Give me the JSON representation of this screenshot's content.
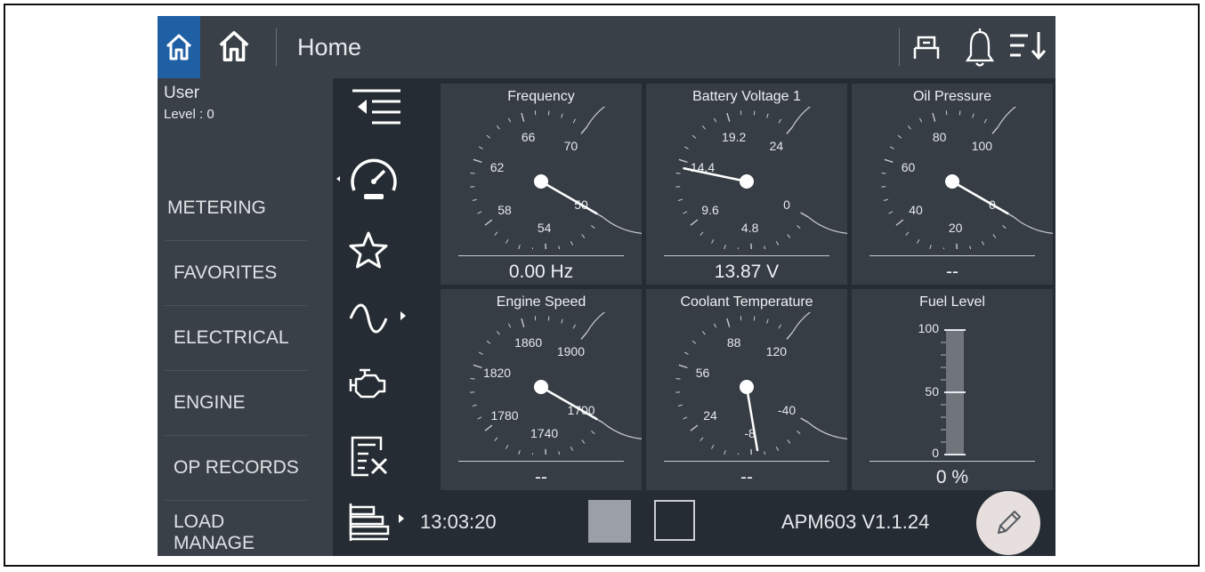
{
  "header": {
    "title": "Home"
  },
  "user": {
    "name": "User",
    "level": "Level  : 0"
  },
  "menu": [
    {
      "label": "METERING"
    },
    {
      "label": "FAVORITES"
    },
    {
      "label": "ELECTRICAL"
    },
    {
      "label": "ENGINE"
    },
    {
      "label": "OP RECORDS"
    },
    {
      "label": "LOAD MANAGE"
    }
  ],
  "gauges": [
    {
      "title": "Frequency",
      "value": "0.00 Hz",
      "ticks": [
        "50",
        "54",
        "58",
        "62",
        "66",
        "70"
      ],
      "needle_fraction": 0.0
    },
    {
      "title": "Battery Voltage 1",
      "value": "13.87 V",
      "ticks": [
        "0",
        "4.8",
        "9.6",
        "14.4",
        "19.2",
        "24"
      ],
      "needle_fraction": 0.578
    },
    {
      "title": "Oil Pressure",
      "value": "--",
      "ticks": [
        "0",
        "20",
        "40",
        "60",
        "80",
        "100"
      ],
      "needle_fraction": 0.0
    },
    {
      "title": "Engine Speed",
      "value": "--",
      "ticks": [
        "1700",
        "1740",
        "1780",
        "1820",
        "1860",
        "1900"
      ],
      "needle_fraction": 0.0
    },
    {
      "title": "Coolant Temperature",
      "value": "--",
      "ticks": [
        "-40",
        "-8",
        "24",
        "56",
        "88",
        "120"
      ],
      "needle_fraction": 0.18
    }
  ],
  "fuel": {
    "title": "Fuel Level",
    "value": "0 %",
    "ticks": [
      "100",
      "50",
      "0"
    ],
    "level_percent": 0
  },
  "status": {
    "time": "13:03:20",
    "version": "APM603 V1.1.24"
  },
  "colors": {
    "accent": "#1f5fa3",
    "background": "#252c33",
    "panel": "#363d45",
    "edit_button": "#e6dfdd"
  },
  "icons": {
    "header": [
      "home-icon",
      "home-icon",
      "keyboard-icon",
      "bell-icon",
      "sort-icon"
    ],
    "iconbar": [
      "collapse-menu-icon",
      "speedometer-icon",
      "star-icon",
      "sine-wave-icon",
      "engine-icon",
      "records-tools-icon",
      "load-bars-icon"
    ],
    "edit": "pencil-icon"
  }
}
